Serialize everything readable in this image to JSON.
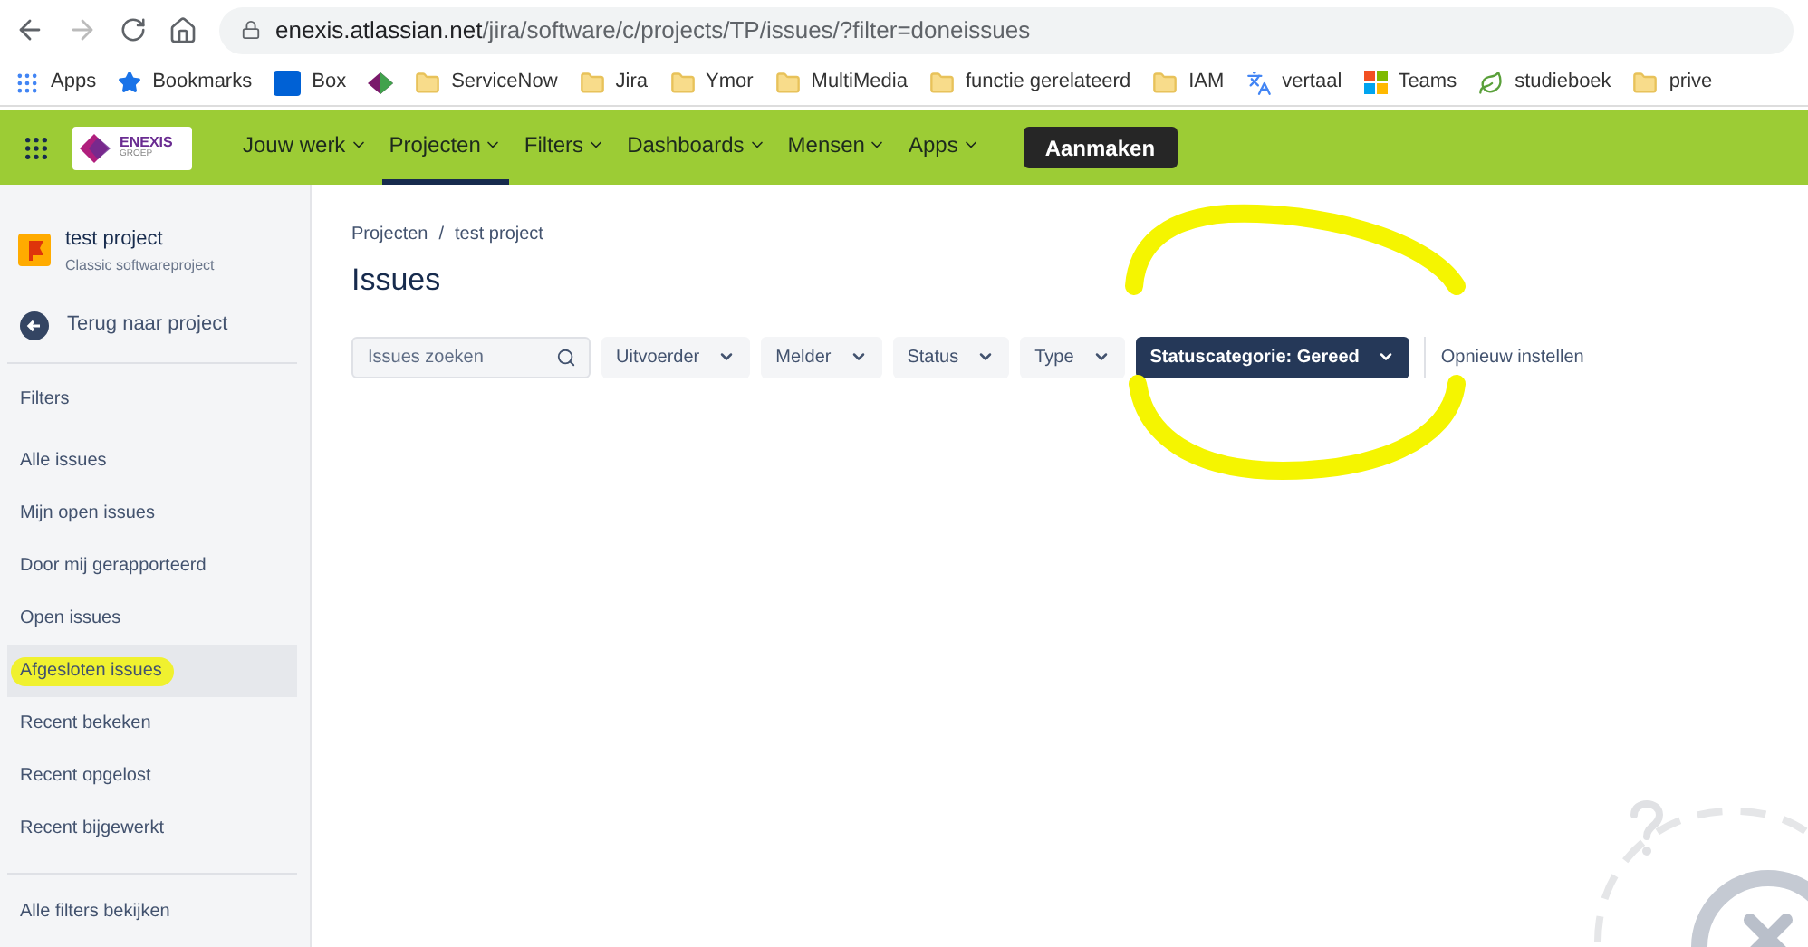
{
  "browser": {
    "url_host": "enexis.atlassian.net",
    "url_path": "/jira/software/c/projects/TP/issues/?filter=doneissues",
    "bookmarks": [
      {
        "kind": "apps",
        "label": "Apps"
      },
      {
        "kind": "star",
        "label": "Bookmarks"
      },
      {
        "kind": "box",
        "label": "Box"
      },
      {
        "kind": "diamond"
      },
      {
        "kind": "folder",
        "label": "ServiceNow"
      },
      {
        "kind": "folder",
        "label": "Jira"
      },
      {
        "kind": "folder",
        "label": "Ymor"
      },
      {
        "kind": "folder",
        "label": "MultiMedia"
      },
      {
        "kind": "folder",
        "label": "functie gerelateerd"
      },
      {
        "kind": "folder",
        "label": "IAM"
      },
      {
        "kind": "translate",
        "label": "vertaal"
      },
      {
        "kind": "tiles",
        "label": "Teams"
      },
      {
        "kind": "leaf",
        "label": "studieboek"
      },
      {
        "kind": "folder",
        "label": "prive"
      }
    ]
  },
  "topnav": {
    "logo_text": "ENEXIS",
    "logo_subtext": "GROEP",
    "items": [
      {
        "label": "Jouw werk",
        "selected": false
      },
      {
        "label": "Projecten",
        "selected": true
      },
      {
        "label": "Filters",
        "selected": false
      },
      {
        "label": "Dashboards",
        "selected": false
      },
      {
        "label": "Mensen",
        "selected": false
      },
      {
        "label": "Apps",
        "selected": false
      }
    ],
    "create_button": "Aanmaken"
  },
  "sidebar": {
    "project_name": "test project",
    "project_type": "Classic softwareproject",
    "back_link": "Terug naar project",
    "section_title": "Filters",
    "items": [
      {
        "label": "Alle issues",
        "selected": false,
        "highlighted": false
      },
      {
        "label": "Mijn open issues",
        "selected": false,
        "highlighted": false
      },
      {
        "label": "Door mij gerapporteerd",
        "selected": false,
        "highlighted": false
      },
      {
        "label": "Open issues",
        "selected": false,
        "highlighted": false
      },
      {
        "label": "Afgesloten issues",
        "selected": true,
        "highlighted": true
      },
      {
        "label": "Recent bekeken",
        "selected": false,
        "highlighted": false
      },
      {
        "label": "Recent opgelost",
        "selected": false,
        "highlighted": false
      },
      {
        "label": "Recent bijgewerkt",
        "selected": false,
        "highlighted": false
      }
    ],
    "all_filters_link": "Alle filters bekijken"
  },
  "main": {
    "breadcrumbs": [
      "Projecten",
      "test project"
    ],
    "breadcrumb_separator": "/",
    "title": "Issues",
    "search": {
      "placeholder": "Issues zoeken"
    },
    "filters": [
      {
        "label": "Uitvoerder",
        "selected": false
      },
      {
        "label": "Melder",
        "selected": false
      },
      {
        "label": "Status",
        "selected": false
      },
      {
        "label": "Type",
        "selected": false
      },
      {
        "label": "Statuscategorie: Gereed",
        "selected": true,
        "circled": true
      }
    ],
    "reset_link": "Opnieuw instellen"
  }
}
